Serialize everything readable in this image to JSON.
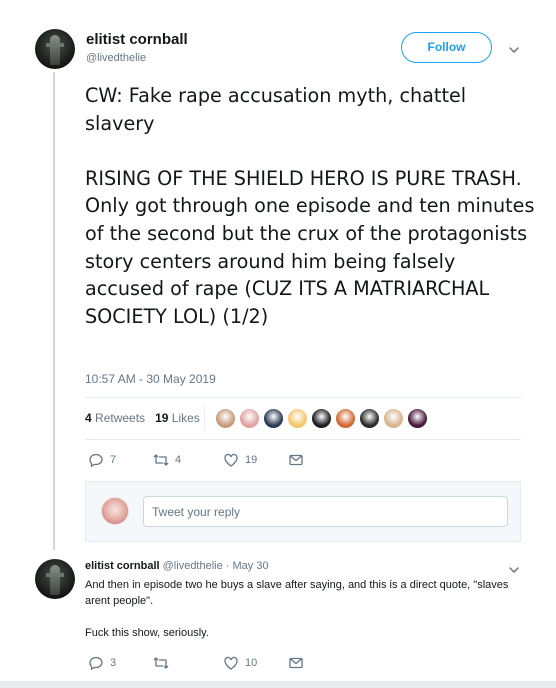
{
  "tweet": {
    "author_name": "elitist cornball",
    "author_handle": "@livedthelie",
    "follow_label": "Follow",
    "text": "CW: Fake rape accusation myth, chattel slavery\n\nRISING OF THE SHIELD HERO IS PURE TRASH. Only got through one episode and ten minutes of the second but the crux of the protagonists story centers around him being falsely accused of rape (CUZ ITS A MATRIARCHAL SOCIETY LOL) (1/2)",
    "timestamp": "10:57 AM - 30 May 2019",
    "retweets_count": "4",
    "retweets_label": "Retweets",
    "likes_count": "19",
    "likes_label": "Likes",
    "actions": {
      "replies": "7",
      "retweets": "4",
      "likes": "19"
    }
  },
  "likers": [
    {
      "name": "liker-1",
      "color": "#c79b7a"
    },
    {
      "name": "liker-2",
      "color": "#e0a2a0"
    },
    {
      "name": "liker-3",
      "color": "#2c3b55"
    },
    {
      "name": "liker-4",
      "color": "#f2c76e"
    },
    {
      "name": "liker-5",
      "color": "#1e1e24"
    },
    {
      "name": "liker-6",
      "color": "#d26a35"
    },
    {
      "name": "liker-7",
      "color": "#2b2b2b"
    },
    {
      "name": "liker-8",
      "color": "#d9b48f"
    },
    {
      "name": "liker-9",
      "color": "#4a1a3a"
    }
  ],
  "reply_box": {
    "placeholder": "Tweet your reply"
  },
  "reply": {
    "author_name": "elitist cornball",
    "author_handle": "@livedthelie",
    "date": "· May 30",
    "text": "And then in episode two he buys a slave after saying, and this is a direct quote, \"slaves arent people\".\n\nFuck this show, seriously.",
    "actions": {
      "replies": "3",
      "retweets": "",
      "likes": "10"
    }
  },
  "colors": {
    "accent": "#1da1f2",
    "muted": "#657786",
    "text": "#14171a",
    "border": "#e6ecf0"
  },
  "icons": [
    "caret-down-icon",
    "reply-icon",
    "retweet-icon",
    "like-icon",
    "message-icon"
  ]
}
